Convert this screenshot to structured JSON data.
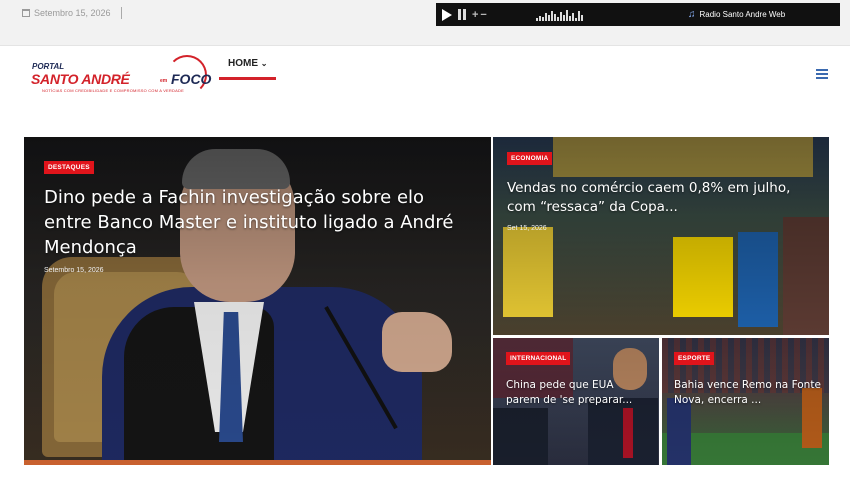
{
  "topbar": {
    "date": "Setembro 15, 2026",
    "player": {
      "radio_name": "Radio Santo Andre Web"
    }
  },
  "header": {
    "logo": {
      "portal": "PORTAL",
      "name_part1": "SANTO ANDRÉ",
      "name_em": "em",
      "name_part2": "FOCO",
      "tagline": "NOTÍCIAS COM CREDIBILIDADE E COMPROMISSO COM A VERDADE"
    },
    "nav": {
      "home_label": "HOME"
    }
  },
  "featured": {
    "main": {
      "category": "DESTAQUES",
      "title": "Dino pede a Fachin investigação sobre elo entre Banco Master e instituto ligado a André Mendonça",
      "date": "Setembro 15, 2026"
    },
    "economia": {
      "category": "ECONOMIA",
      "title": "Vendas no comércio caem 0,8% em julho, com “ressaca” da Copa...",
      "date": "Set 15, 2026"
    },
    "internacional": {
      "category": "INTERNACIONAL",
      "title": "China pede que EUA parem de 'se preparar...",
      "date": ""
    },
    "esporte": {
      "category": "ESPORTE",
      "title": "Bahia vence Remo na Fonte Nova, encerra ...",
      "date": ""
    }
  },
  "colors": {
    "accent": "#e0141b",
    "brand_blue": "#1e2a55",
    "menu_icon": "#3b6ab0"
  }
}
